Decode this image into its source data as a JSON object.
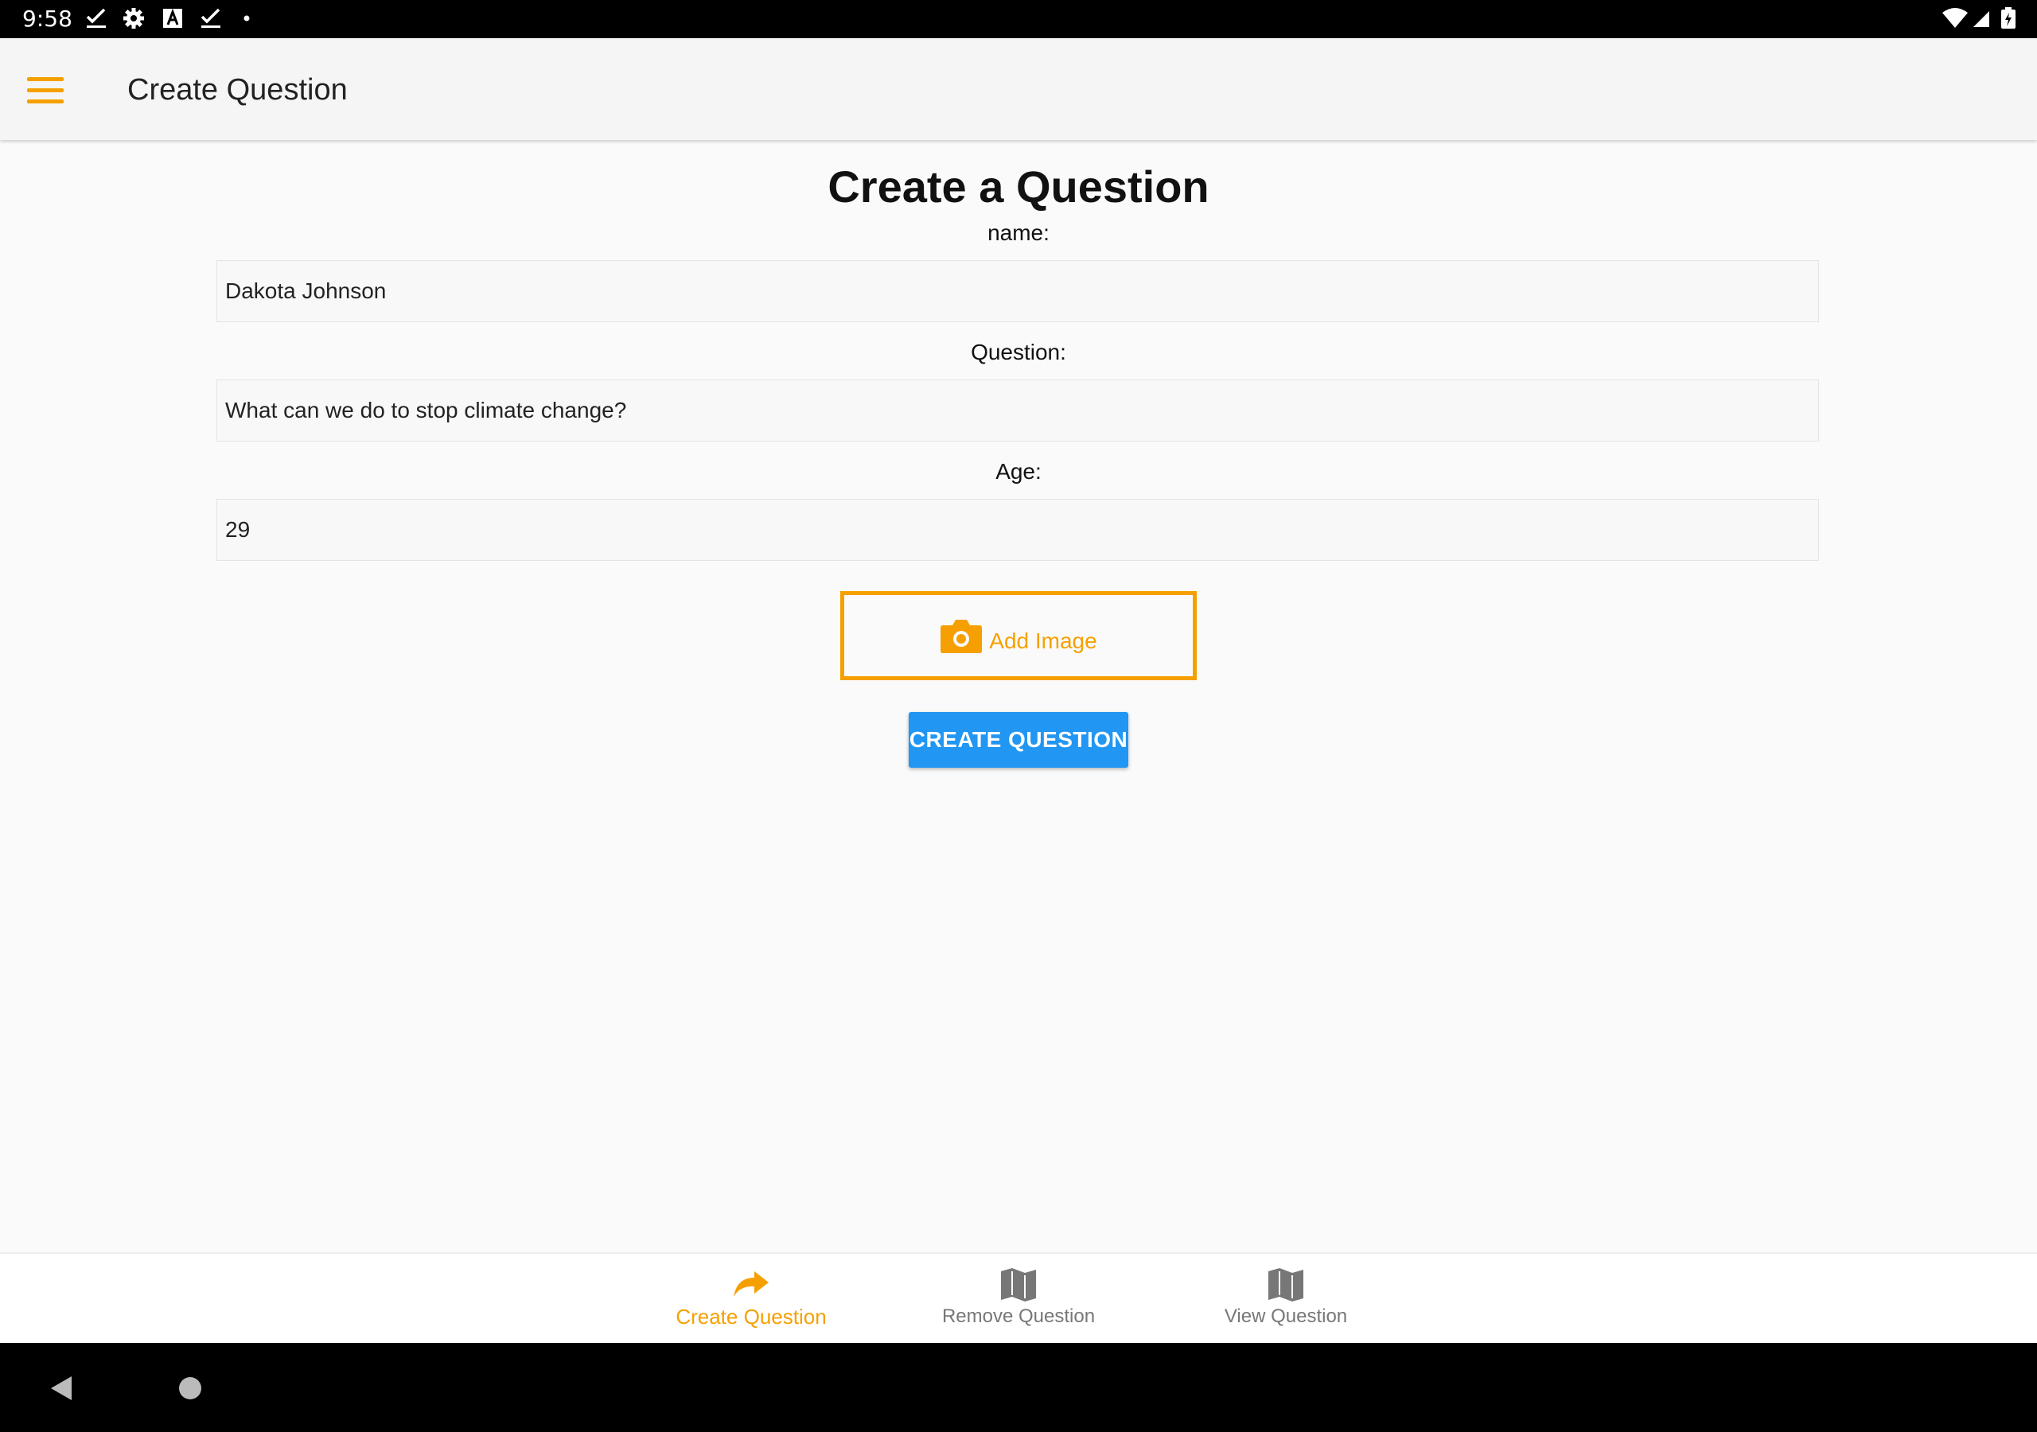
{
  "status_bar": {
    "time": "9:58",
    "icons": [
      "check-download-icon",
      "gear-icon",
      "a-badge-icon",
      "check-download-icon",
      "dot-icon",
      "wifi-icon",
      "signal-icon",
      "battery-icon"
    ]
  },
  "app_bar": {
    "menu_icon": "hamburger-menu-icon",
    "title": "Create Question"
  },
  "form": {
    "heading": "Create a Question",
    "name_label": "name:",
    "name_value": "Dakota Johnson",
    "question_label": "Question:",
    "question_value": "What can we do to stop climate change?",
    "age_label": "Age:",
    "age_value": "29",
    "add_image_label": "Add Image",
    "add_image_icon": "camera-icon",
    "submit_label": "CREATE QUESTION"
  },
  "bottom_nav": {
    "items": [
      {
        "label": "Create Question",
        "icon": "share-arrow-icon",
        "active": true
      },
      {
        "label": "Remove Question",
        "icon": "map-icon",
        "active": false
      },
      {
        "label": "View Question",
        "icon": "map-icon",
        "active": false
      }
    ]
  },
  "colors": {
    "accent": "#f5a000",
    "primary_button": "#2196f3",
    "background": "#fafafa",
    "app_bar": "#f5f5f5"
  }
}
